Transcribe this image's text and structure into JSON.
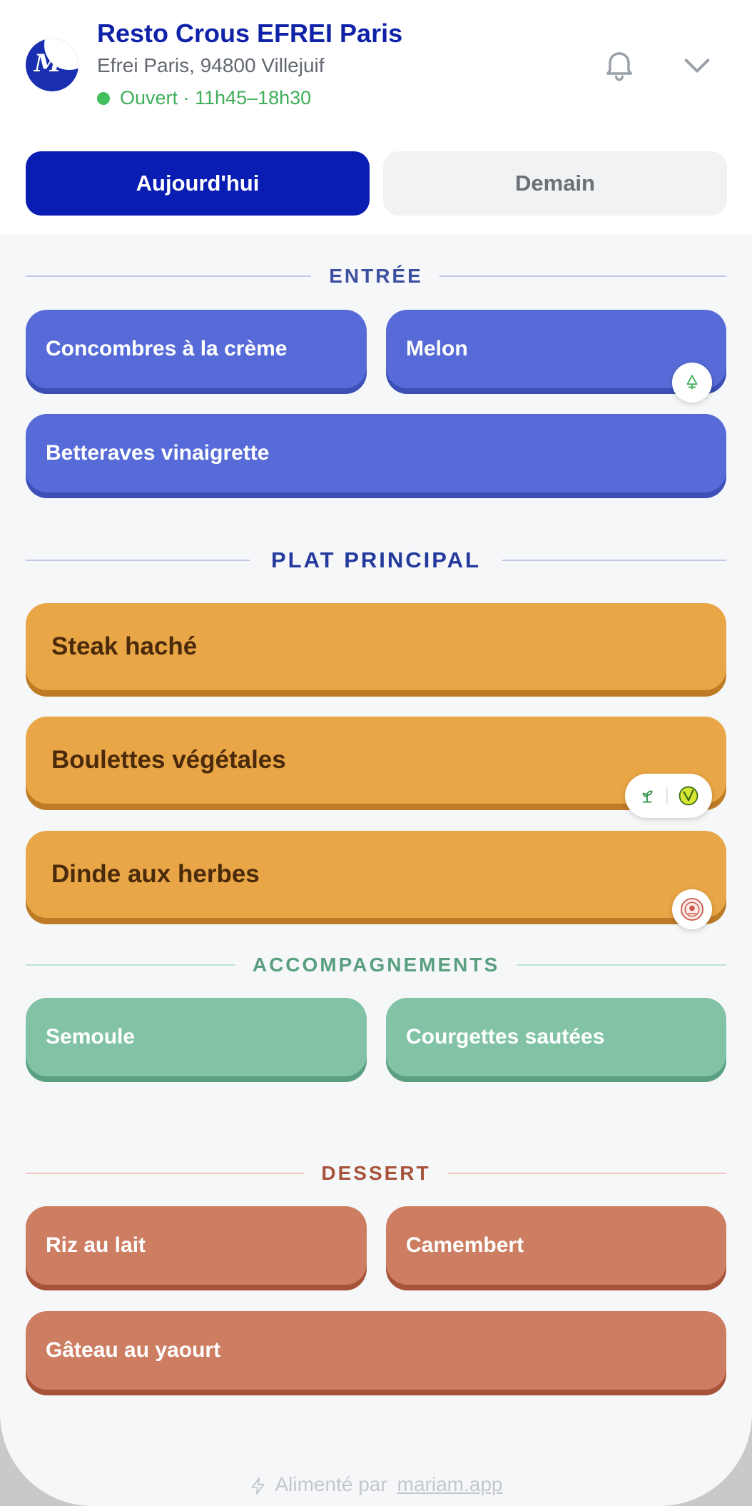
{
  "header": {
    "title": "Resto Crous EFREI Paris",
    "address": "Efrei Paris, 94800 Villejuif",
    "status": "Ouvert · 11h45–18h30",
    "status_color": "#43c05e",
    "icons": [
      "bell-icon",
      "chevron-down-icon"
    ]
  },
  "tabs": [
    {
      "label": "Aujourd'hui",
      "active": true
    },
    {
      "label": "Demain",
      "active": false
    }
  ],
  "sections": {
    "entree": {
      "title": "ENTRÉE",
      "color": "#3d4ea0",
      "items": [
        "Concombres à la crème",
        "Melon",
        "Betteraves vinaigrette"
      ]
    },
    "plat": {
      "title": "PLAT PRINCIPAL",
      "color": "#233a9c",
      "items": [
        "Steak haché",
        "Boulettes végétales",
        "Dinde aux herbes"
      ]
    },
    "accompagnements": {
      "title": "ACCOMPAGNEMENTS",
      "color": "#5a9f80",
      "items": [
        "Semoule",
        "Courgettes sautées"
      ]
    },
    "dessert": {
      "title": "DESSERT",
      "color": "#a6533a",
      "items": [
        "Riz au lait",
        "Camembert",
        "Gâteau au yaourt"
      ]
    }
  },
  "badges": {
    "melon": [
      "tree-icon"
    ],
    "boulettes": [
      "sprout-icon",
      "vegan-icon"
    ],
    "dinde": [
      "label-rouge-icon"
    ]
  },
  "footer": {
    "prefix": "Alimenté par",
    "link": "mariam.app",
    "icon": "bolt-icon"
  }
}
